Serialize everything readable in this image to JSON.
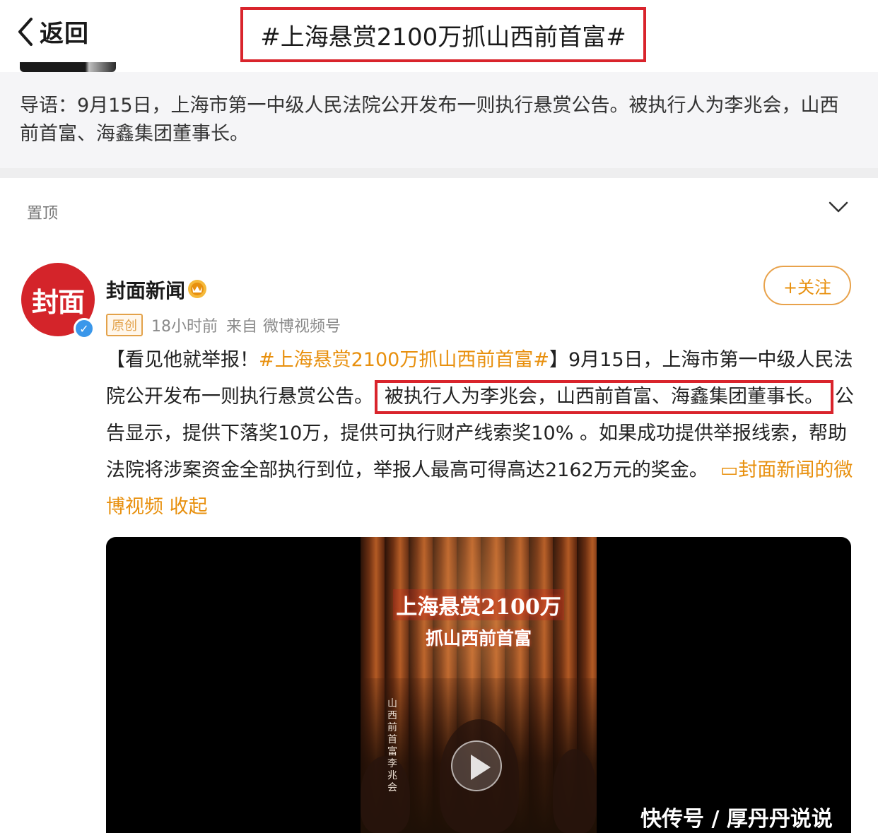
{
  "header": {
    "back_label": "返回",
    "title": "#上海悬赏2100万抓山西前首富#"
  },
  "intro": {
    "text": "导语：9月15日，上海市第一中级人民法院公开发布一则执行悬赏公告。被执行人为李兆会，山西前首富、海鑫集团董事长。"
  },
  "post": {
    "pinned_label": "置顶",
    "avatar_text": "封面",
    "author": "封面新闻",
    "original_badge": "原创",
    "time": "18小时前",
    "source_prefix": "来自",
    "source": "微博视频号",
    "follow_label": "+关注",
    "text_lead": "【看见他就举报！",
    "hashtag": "#上海悬赏2100万抓山西前首富#",
    "text_part1": "】9月15日，上海市第一中级人民法院公开发布一则执行悬赏公告。",
    "text_boxed": "被执行人为李兆会，山西前首富、海鑫集团董事长。",
    "text_part2": "公告显示，提供下落奖10万，提供可执行财产线索奖10% 。如果成功提供举报线索，帮助法院将涉案资金全部执行到位，举报人最高可得高达2162万元的奖金。",
    "video_link": "封面新闻的微博视频",
    "fold_label": "收起"
  },
  "video": {
    "title_line1": "上海悬赏2100万",
    "title_line2": "抓山西前首富",
    "side_caption": "山西前首富李兆会"
  },
  "watermark": "快传号 / 厚丹丹说说",
  "colors": {
    "accent": "#e8900e",
    "highlight_box": "#d9242c",
    "avatar_bg": "#d4242a",
    "verify_blue": "#3a97ea"
  },
  "icons": {
    "back": "chevron-left-icon",
    "collapse": "chevron-down-icon",
    "verify": "verified-badge-icon",
    "vip": "vip-crown-icon",
    "video_link": "video-icon",
    "play": "play-icon"
  }
}
